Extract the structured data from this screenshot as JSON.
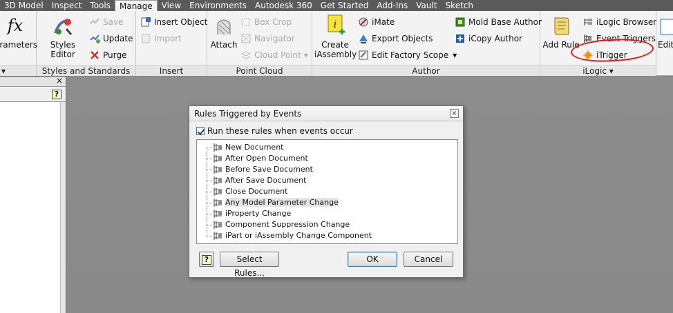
{
  "menubar": [
    "3D Model",
    "Inspect",
    "Tools",
    "Manage",
    "View",
    "Environments",
    "Autodesk 360",
    "Get Started",
    "Add-Ins",
    "Vault",
    "Sketch"
  ],
  "menubar_active": "Manage",
  "ribbon": {
    "params_label": "arameters",
    "styles_panel": {
      "title": "Styles and Standards",
      "editor": "Styles Editor",
      "save": "Save",
      "update": "Update",
      "purge": "Purge"
    },
    "insert_panel": {
      "title": "Insert",
      "insert_object": "Insert Object",
      "import": "Import"
    },
    "pointcloud_panel": {
      "title": "Point Cloud",
      "attach": "Attach",
      "box_crop": "Box Crop",
      "navigator": "Navigator",
      "cloud_point": "Cloud Point"
    },
    "author_panel": {
      "title": "Author",
      "create": "Create",
      "iassembly": "iAssembly",
      "imate": "iMate",
      "export_objects": "Export Objects",
      "edit_factory_scope": "Edit Factory Scope",
      "mold_base_author": "Mold Base Author",
      "icopy_author": "iCopy Author"
    },
    "ilogic_panel": {
      "title": "iLogic",
      "add_rule": "Add Rule",
      "ilogic_browser": "iLogic Browser",
      "event_triggers": "Event Triggers",
      "itrigger": "iTrigger"
    },
    "edit_partial": "Edit"
  },
  "leftpane": {
    "close": "×"
  },
  "dialog": {
    "title": "Rules Triggered by Events",
    "checkbox_label": "Run these rules when events occur",
    "events": [
      "New Document",
      "After Open Document",
      "Before Save Document",
      "After Save Document",
      "Close Document",
      "Any Model Parameter Change",
      "iProperty Change",
      "Component Suppression Change",
      "iPart or iAssembly Change Component"
    ],
    "selected_event": "Any Model Parameter Change",
    "select_rules": "Select Rules...",
    "ok": "OK",
    "cancel": "Cancel"
  },
  "colors": {
    "menubar": "#5a5a5a",
    "canvas": "#8a8a8a",
    "annotation": "#e01818"
  }
}
